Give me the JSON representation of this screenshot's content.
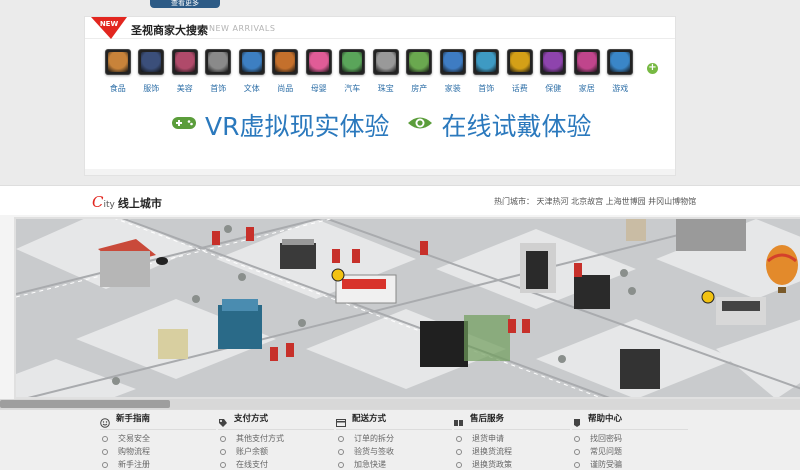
{
  "top_button": {
    "label": "查看更多"
  },
  "search": {
    "badge": "NEW",
    "title": "圣视商家大搜索",
    "subtitle": "NEW ARRIVALS",
    "add_icon": "plus-icon",
    "categories": [
      {
        "label": "食品",
        "icon": "food-icon",
        "color": "#c8833a"
      },
      {
        "label": "服饰",
        "icon": "clothing-icon",
        "color": "#3b4f7a"
      },
      {
        "label": "美容",
        "icon": "cosmetics-icon",
        "color": "#b04a6a"
      },
      {
        "label": "首饰",
        "icon": "jewelry-icon",
        "color": "#8a8a8a"
      },
      {
        "label": "文体",
        "icon": "book-icon",
        "color": "#3d7fc2"
      },
      {
        "label": "尚品",
        "icon": "person-icon",
        "color": "#c4702c"
      },
      {
        "label": "母婴",
        "icon": "baby-icon",
        "color": "#e05c97"
      },
      {
        "label": "汽车",
        "icon": "car-icon",
        "color": "#5aa55a"
      },
      {
        "label": "珠宝",
        "icon": "pearl-icon",
        "color": "#999999"
      },
      {
        "label": "房产",
        "icon": "house-icon",
        "color": "#6aa84f"
      },
      {
        "label": "家装",
        "icon": "globe-icon",
        "color": "#3e7cc3"
      },
      {
        "label": "首饰",
        "icon": "globe-icon",
        "color": "#3e9ac3"
      },
      {
        "label": "话费",
        "icon": "gift-icon",
        "color": "#d4a017"
      },
      {
        "label": "保健",
        "icon": "stripes-icon",
        "color": "#8e44ad"
      },
      {
        "label": "家居",
        "icon": "stripes-icon",
        "color": "#c0458c"
      },
      {
        "label": "游戏",
        "icon": "gift-icon",
        "color": "#3a86c8"
      }
    ],
    "features": [
      {
        "label": "VR虚拟现实体验",
        "icon": "gamepad-icon"
      },
      {
        "label": "在线试戴体验",
        "icon": "eye-icon"
      }
    ]
  },
  "city": {
    "c_letter": "C",
    "ity": "ity",
    "title": "线上城市",
    "hot_cities": "热门城市： 天津热河 北京故宫 上海世博园 井冈山博物馆"
  },
  "help": {
    "columns": [
      {
        "title": "新手指南",
        "icon": "smile-icon",
        "items": [
          "交易安全",
          "购物流程",
          "新手注册"
        ]
      },
      {
        "title": "支付方式",
        "icon": "tag-icon",
        "items": [
          "其他支付方式",
          "账户余额",
          "在线支付"
        ]
      },
      {
        "title": "配送方式",
        "icon": "card-icon",
        "items": [
          "订单的拆分",
          "验货与签收",
          "加急快递"
        ]
      },
      {
        "title": "售后服务",
        "icon": "service-icon",
        "items": [
          "退货申请",
          "退换货流程",
          "退换货政策"
        ]
      },
      {
        "title": "帮助中心",
        "icon": "help-icon",
        "items": [
          "找回密码",
          "常见问题",
          "谨防受骗"
        ]
      }
    ]
  },
  "colors": {
    "accent": "#2b79bd",
    "badge": "#e2261f",
    "plus": "#77b943"
  }
}
